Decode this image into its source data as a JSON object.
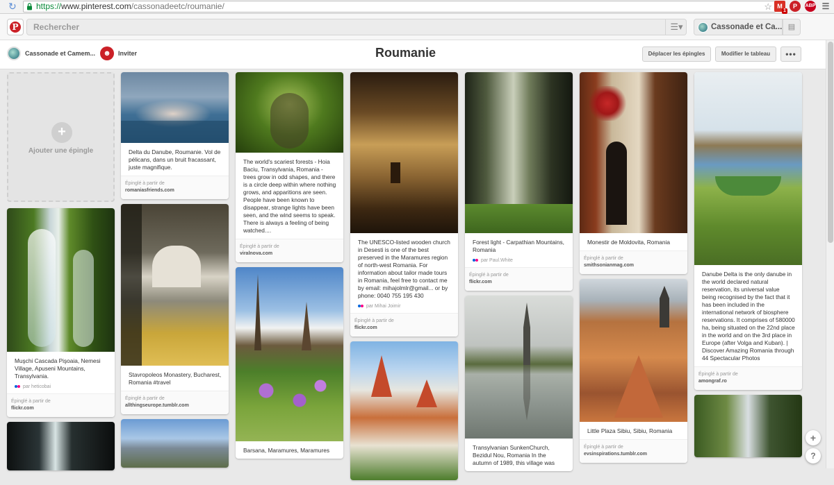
{
  "browser": {
    "url_secure": "https://",
    "url_host": "www.pinterest.com",
    "url_path": "/cassonadeetc/roumanie/",
    "gmail_badge": "1"
  },
  "header": {
    "search_placeholder": "Rechercher",
    "user_name": "Cassonade et Ca..."
  },
  "board": {
    "owner_name": "Cassonade et Camem...",
    "invite_label": "Inviter",
    "title": "Roumanie",
    "move_pins_label": "Déplacer les épingles",
    "edit_board_label": "Modifier le tableau",
    "more_label": "•••",
    "add_pin_label": "Ajouter une épingle"
  },
  "source_prefix": "Épinglé à partir de",
  "pins": [
    {
      "desc": "Delta du Danube, Roumanie. Vol de pélicans, dans un bruit fracassant, juste magnifique.",
      "via": "",
      "source": "romaniasfriends.com"
    },
    {
      "desc": "Muşchi Cascada Pişoaia, Nemesi Village, Apuseni Mountains, Transylvania.",
      "via": "par heticobai",
      "source": "flickr.com"
    },
    {
      "desc": "Stavropoleos Monastery, Bucharest, Romania #travel",
      "via": "",
      "source": "allthingseurope.tumblr.com"
    },
    {
      "desc": "The world's scariest forests - Hoia Baciu, Transylvania, Romania - trees grow in odd shapes, and there is a circle deep within where nothing grows, and apparitions are seen. People have been known to disappear, strange lights have been seen, and the wind seems to speak. There is always a feeling of being watched....",
      "via": "",
      "source": "viralnova.com"
    },
    {
      "desc": "Barsana, Maramures, Maramures",
      "via": "",
      "source": ""
    },
    {
      "desc": "The UNESCO-listed wooden church in Desesti is one of the best preserved in the Maramures region of north-west Romania. For information about tailor made tours in Romania, feel free to contact me by email: mihajolmlr@gmail... or by phone: 0040 755 195 430",
      "via": "par Mihai Joimir",
      "source": "flickr.com"
    },
    {
      "desc": "Forest light - Carpathian Mountains, Romania",
      "via": "par Paul.White",
      "source": "flickr.com"
    },
    {
      "desc": "Transylvanian SunkenChurch, Bezidul Nou, Romania In the autumn of 1989, this village was",
      "via": "",
      "source": ""
    },
    {
      "desc": "Monestir de Moldovita, Romania",
      "via": "",
      "source": "smithsonianmag.com"
    },
    {
      "desc": "Little Plaza Sibiu, Sibiu, Romania",
      "via": "",
      "source": "evsinspirations.tumblr.com"
    },
    {
      "desc": "Danube Delta is the only danube in the world declared natural reservation, its universal value being recognised by the fact that it has been included in the international network of biosphere reservations. It comprises of 580000 ha, being situated on the 22nd place in the world and on the 3rd place in Europe (after Volga and Kuban). | Discover Amazing Romania through 44 Spectacular Photos",
      "via": "",
      "source": "amongraf.ro"
    }
  ],
  "colors": {
    "brand_red": "#cb2027",
    "flickr_blue": "#0063dc",
    "flickr_pink": "#ff0084"
  }
}
